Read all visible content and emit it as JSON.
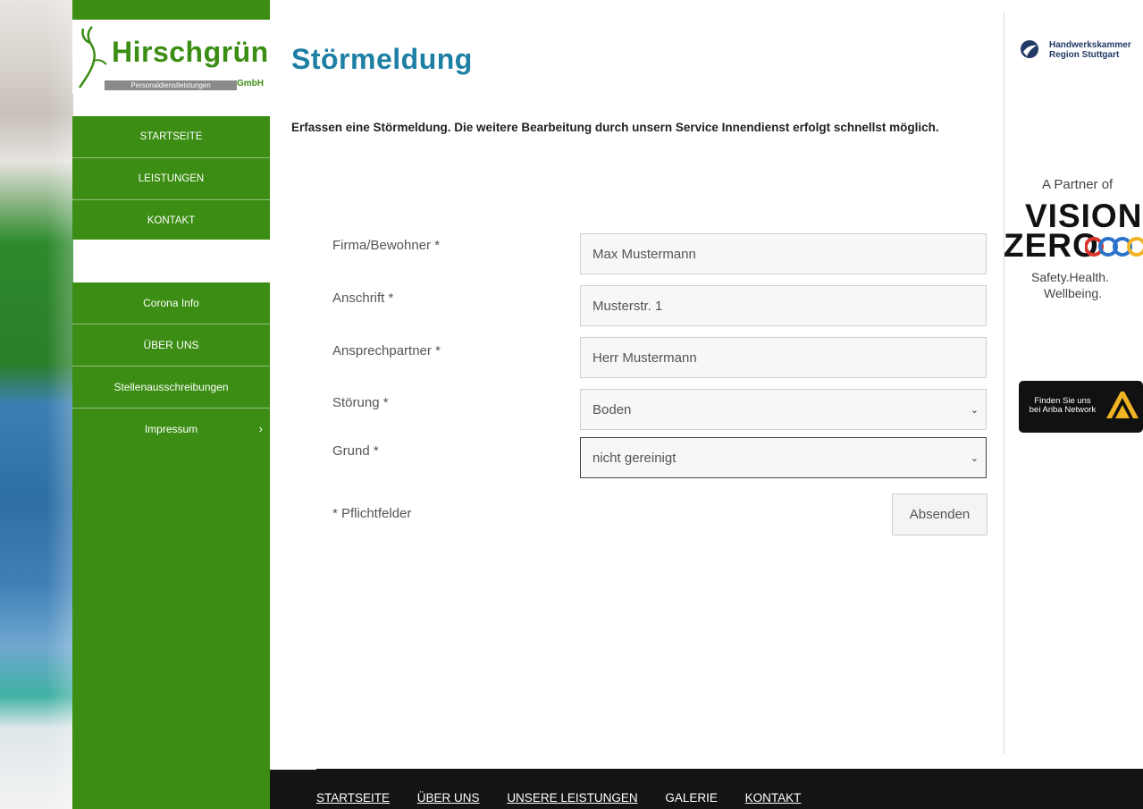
{
  "brand": {
    "name": "Hirschgrün",
    "subtitle": "Personaldienstleistungen",
    "suffix": "GmbH",
    "color": "#3b8d13"
  },
  "sidebar": {
    "top_menu": [
      {
        "label": "STARTSEITE"
      },
      {
        "label": "LEISTUNGEN"
      },
      {
        "label": "KONTAKT"
      }
    ],
    "bottom_menu": [
      {
        "label": "Corona Info"
      },
      {
        "label": "ÜBER UNS"
      },
      {
        "label": "Stellenausschreibungen"
      },
      {
        "label": "Impressum",
        "icon": "chevron-right-icon"
      }
    ]
  },
  "main": {
    "title": "Störmeldung",
    "intro": "Erfassen eine Störmeldung. Die weitere Bearbeitung durch unsern Service Innendienst erfolgt schnellst möglich.",
    "form": {
      "fields": [
        {
          "label": "Firma/Bewohner *",
          "value": "Max Mustermann",
          "type": "text"
        },
        {
          "label": "Anschrift *",
          "value": "Musterstr. 1",
          "type": "text"
        },
        {
          "label": "Ansprechpartner *",
          "value": "Herr Mustermann",
          "type": "text"
        },
        {
          "label": "Störung *",
          "value": "Boden",
          "type": "select"
        },
        {
          "label": "Grund *",
          "value": "nicht gereinigt",
          "type": "select"
        }
      ],
      "required_note": "* Pflichtfelder",
      "submit_label": "Absenden"
    },
    "title_color": "#1d7fa3"
  },
  "right_column": {
    "hwk": {
      "line1": "Handwerkskammer",
      "line2": "Region Stuttgart"
    },
    "vision_zero": {
      "partner": "A Partner of",
      "word1": "VISION",
      "word2": "ZERO",
      "tag1": "Safety.Health.",
      "tag2": "Wellbeing."
    },
    "ariba": {
      "line1": "Finden Sie uns",
      "line2": "bei Ariba Network"
    }
  },
  "footer": {
    "links": [
      {
        "label": "STARTSEITE"
      },
      {
        "label": "ÜBER UNS"
      },
      {
        "label": "UNSERE LEISTUNGEN"
      },
      {
        "label": "GALERIE"
      },
      {
        "label": "KONTAKT"
      }
    ]
  }
}
